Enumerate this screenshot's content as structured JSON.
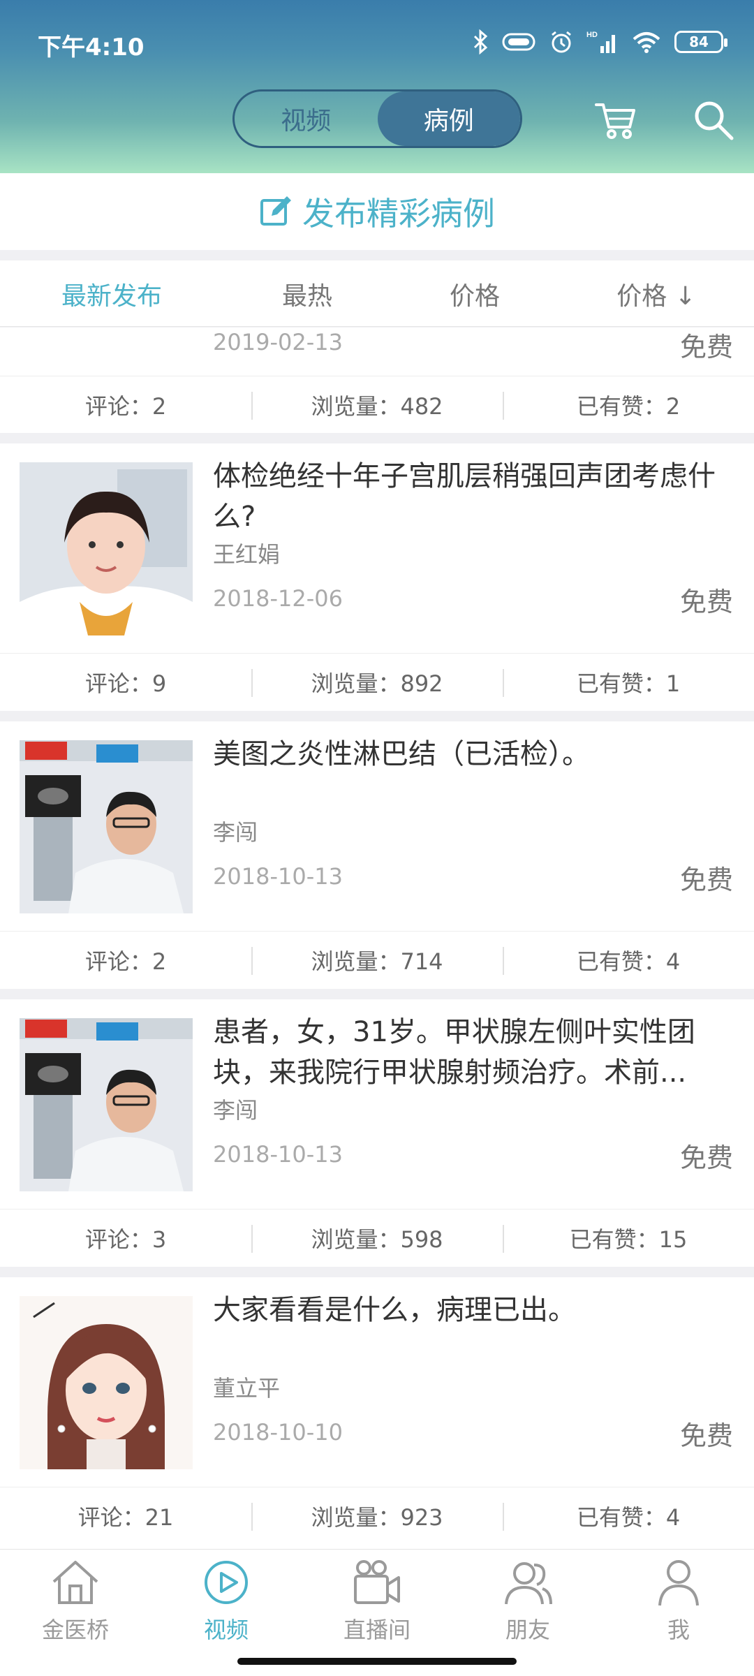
{
  "status": {
    "time": "下午4:10",
    "battery": "84"
  },
  "header": {
    "tabs": [
      {
        "label": "视频",
        "active": false
      },
      {
        "label": "病例",
        "active": true
      }
    ]
  },
  "publish": {
    "label": "发布精彩病例"
  },
  "sort_tabs": [
    "最新发布",
    "最热",
    "价格",
    "价格 ↓"
  ],
  "cards": [
    {
      "title": "",
      "author": "",
      "date": "2019-02-13",
      "price": "免费",
      "comments": "评论：2",
      "views": "浏览量：482",
      "likes": "已有赞：2"
    },
    {
      "title": "体检绝经十年子宫肌层稍强回声团考虑什么?",
      "author": "王红娟",
      "date": "2018-12-06",
      "price": "免费",
      "comments": "评论：9",
      "views": "浏览量：892",
      "likes": "已有赞：1"
    },
    {
      "title": "美图之炎性淋巴结（已活检）。",
      "author": "李闯",
      "date": "2018-10-13",
      "price": "免费",
      "comments": "评论：2",
      "views": "浏览量：714",
      "likes": "已有赞：4"
    },
    {
      "title": "患者，女，31岁。甲状腺左侧叶实性团块，来我院行甲状腺射频治疗。术前...",
      "author": "李闯",
      "date": "2018-10-13",
      "price": "免费",
      "comments": "评论：3",
      "views": "浏览量：598",
      "likes": "已有赞：15"
    },
    {
      "title": "大家看看是什么，病理已出。",
      "author": "董立平",
      "date": "2018-10-10",
      "price": "免费",
      "comments": "评论：21",
      "views": "浏览量：923",
      "likes": "已有赞：4"
    }
  ],
  "nav": [
    {
      "label": "金医桥",
      "icon": "home-icon"
    },
    {
      "label": "视频",
      "icon": "play-icon",
      "active": true
    },
    {
      "label": "直播间",
      "icon": "video-camera-icon"
    },
    {
      "label": "朋友",
      "icon": "friends-icon"
    },
    {
      "label": "我",
      "icon": "person-icon"
    }
  ]
}
